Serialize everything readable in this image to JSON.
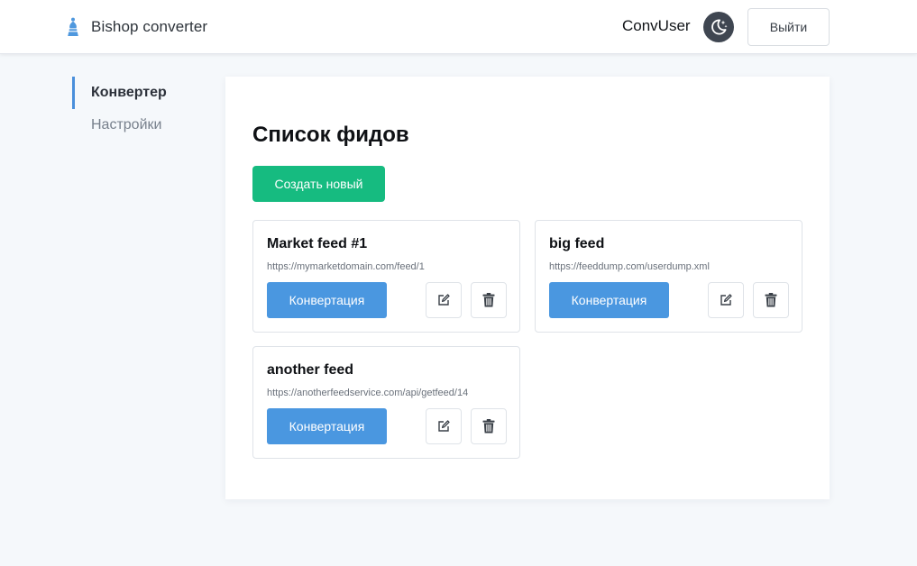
{
  "app": {
    "brand": "Bishop converter",
    "username": "ConvUser",
    "logout_label": "Выйти"
  },
  "sidebar": {
    "items": [
      {
        "label": "Конвертер",
        "active": true
      },
      {
        "label": "Настройки",
        "active": false
      }
    ]
  },
  "main": {
    "title": "Список фидов",
    "create_label": "Создать новый",
    "feeds": [
      {
        "name": "Market feed #1",
        "url": "https://mymarketdomain.com/feed/1",
        "convert_label": "Конвертация"
      },
      {
        "name": "big feed",
        "url": "https://feeddump.com/userdump.xml",
        "convert_label": "Конвертация"
      },
      {
        "name": "another feed",
        "url": "https://anotherfeedservice.com/api/getfeed/14",
        "convert_label": "Конвертация"
      }
    ]
  },
  "colors": {
    "accent_green": "#16bb80",
    "accent_blue": "#4a97e0",
    "nav_active_bar": "#4a8fdb"
  },
  "icons": {
    "brand": "bishop-icon",
    "theme": "moon-stars-icon",
    "edit": "edit-icon",
    "delete": "trash-icon"
  }
}
